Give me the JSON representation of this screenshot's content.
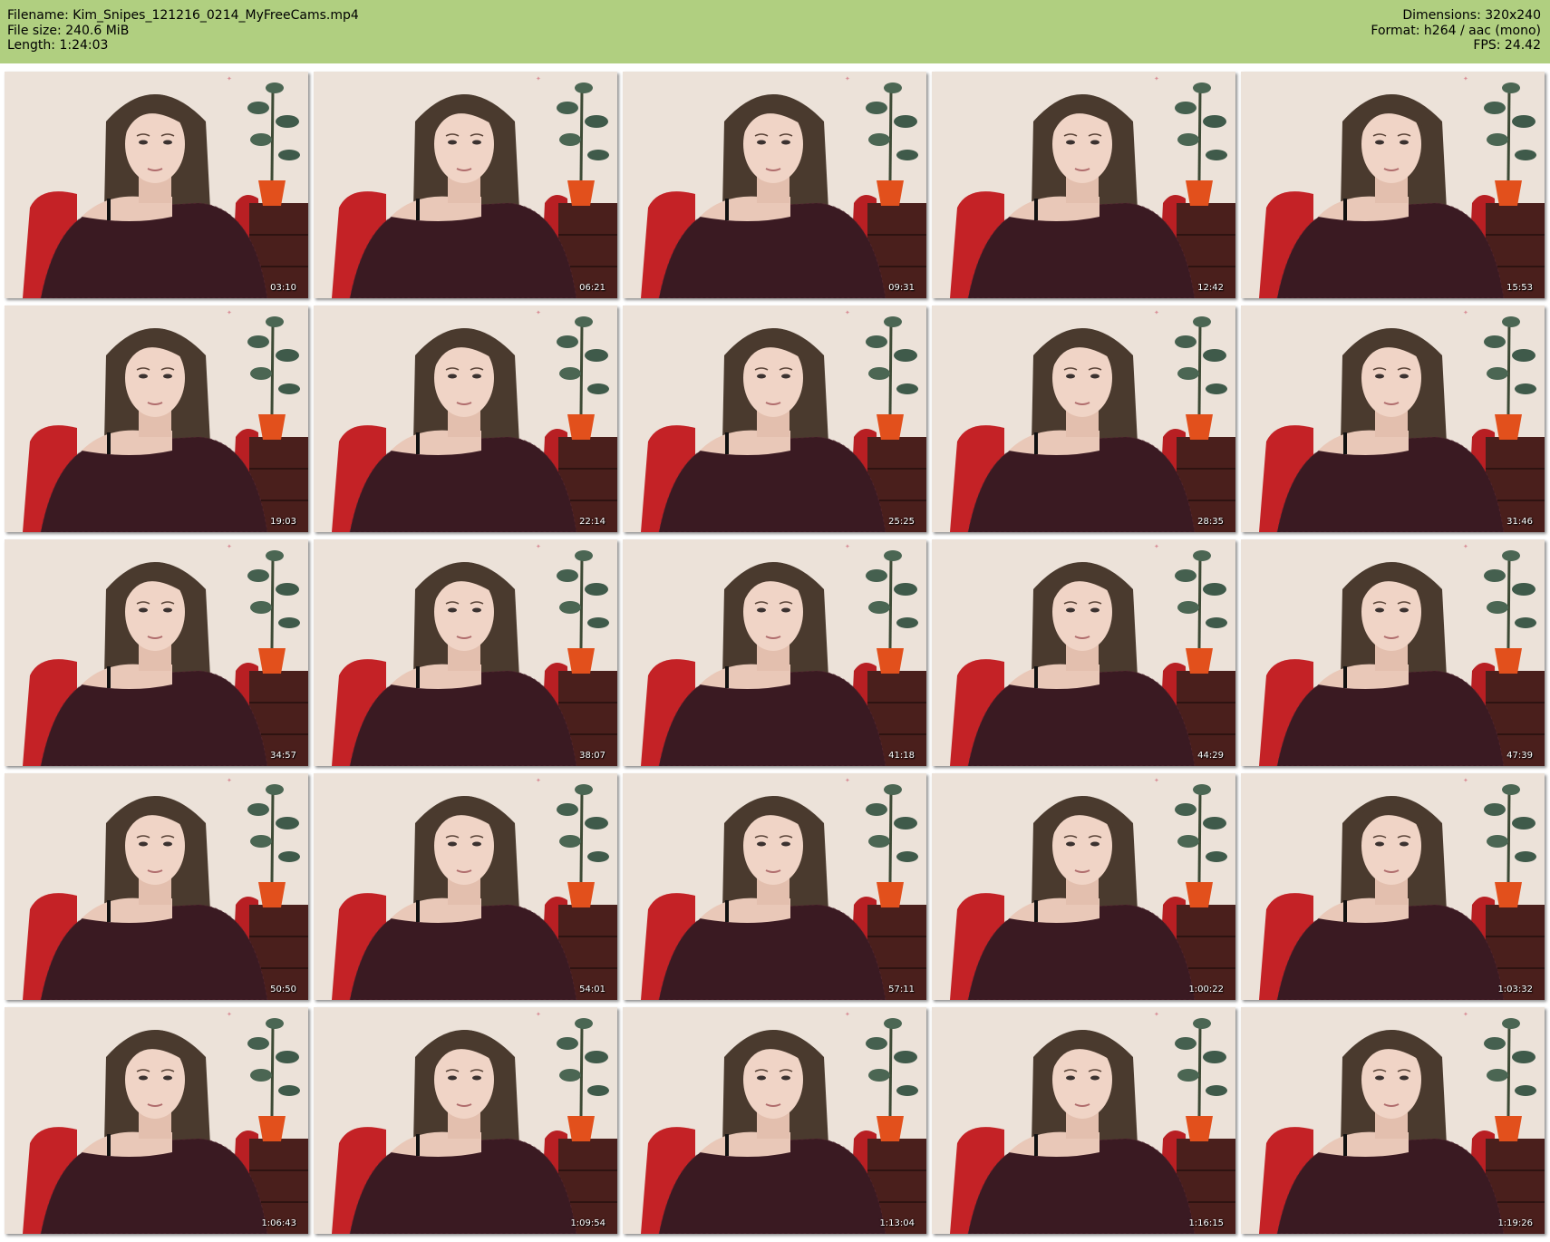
{
  "header": {
    "filename_line": "Filename: Kim_Snipes_121216_0214_MyFreeCams.mp4",
    "filesize_line": "File size: 240.6 MiB",
    "length_line": "Length: 1:24:03",
    "dimensions_line": "Dimensions: 320x240",
    "format_line": "Format: h264 / aac (mono)",
    "fps_line": "FPS: 24.42"
  },
  "colors": {
    "header_bg": "#b0cf80",
    "wall": "#e9dfd6",
    "sweater": "#3a1a22",
    "chair": "#c42226",
    "pot": "#e2501c"
  },
  "thumbnails": [
    {
      "time": "03:10"
    },
    {
      "time": "06:21"
    },
    {
      "time": "09:31"
    },
    {
      "time": "12:42"
    },
    {
      "time": "15:53"
    },
    {
      "time": "19:03"
    },
    {
      "time": "22:14"
    },
    {
      "time": "25:25"
    },
    {
      "time": "28:35"
    },
    {
      "time": "31:46"
    },
    {
      "time": "34:57"
    },
    {
      "time": "38:07"
    },
    {
      "time": "41:18"
    },
    {
      "time": "44:29"
    },
    {
      "time": "47:39"
    },
    {
      "time": "50:50"
    },
    {
      "time": "54:01"
    },
    {
      "time": "57:11"
    },
    {
      "time": "1:00:22"
    },
    {
      "time": "1:03:32"
    },
    {
      "time": "1:06:43"
    },
    {
      "time": "1:09:54"
    },
    {
      "time": "1:13:04"
    },
    {
      "time": "1:16:15"
    },
    {
      "time": "1:19:26"
    }
  ]
}
